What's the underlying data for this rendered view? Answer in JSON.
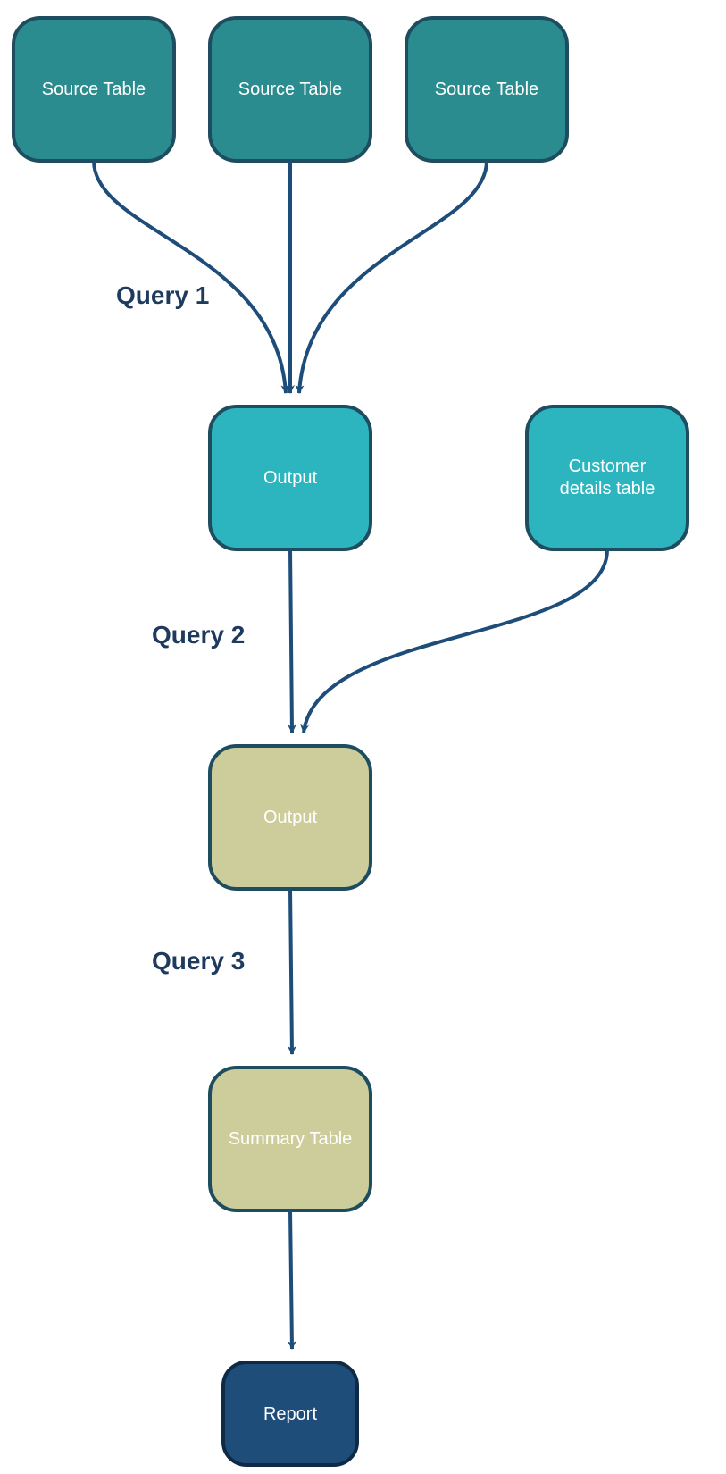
{
  "nodes": {
    "source1": {
      "label": "Source Table",
      "fill": "#2a8c8f",
      "stroke": "#1e4d5f",
      "textColor": "#ffffff"
    },
    "source2": {
      "label": "Source Table",
      "fill": "#2a8c8f",
      "stroke": "#1e4d5f",
      "textColor": "#ffffff"
    },
    "source3": {
      "label": "Source Table",
      "fill": "#2a8c8f",
      "stroke": "#1e4d5f",
      "textColor": "#ffffff"
    },
    "output1": {
      "label": "Output",
      "fill": "#2db5bf",
      "stroke": "#1e4d5f",
      "textColor": "#ffffff"
    },
    "customer": {
      "label_line1": "Customer",
      "label_line2": "details table",
      "fill": "#2db5bf",
      "stroke": "#1e4d5f",
      "textColor": "#ffffff"
    },
    "output2": {
      "label": "Output",
      "fill": "#cdcd9c",
      "stroke": "#1e4d5f",
      "textColor": "#ffffff"
    },
    "summary": {
      "label": "Summary Table",
      "fill": "#cdcd9c",
      "stroke": "#1e4d5f",
      "textColor": "#ffffff"
    },
    "report": {
      "label": "Report",
      "fill": "#1e4d7a",
      "stroke": "#0f2a45",
      "textColor": "#ffffff"
    }
  },
  "labels": {
    "query1": "Query 1",
    "query2": "Query 2",
    "query3": "Query 3"
  },
  "colors": {
    "arrow": "#1e4d7a",
    "labelText": "#1e3a5f"
  }
}
